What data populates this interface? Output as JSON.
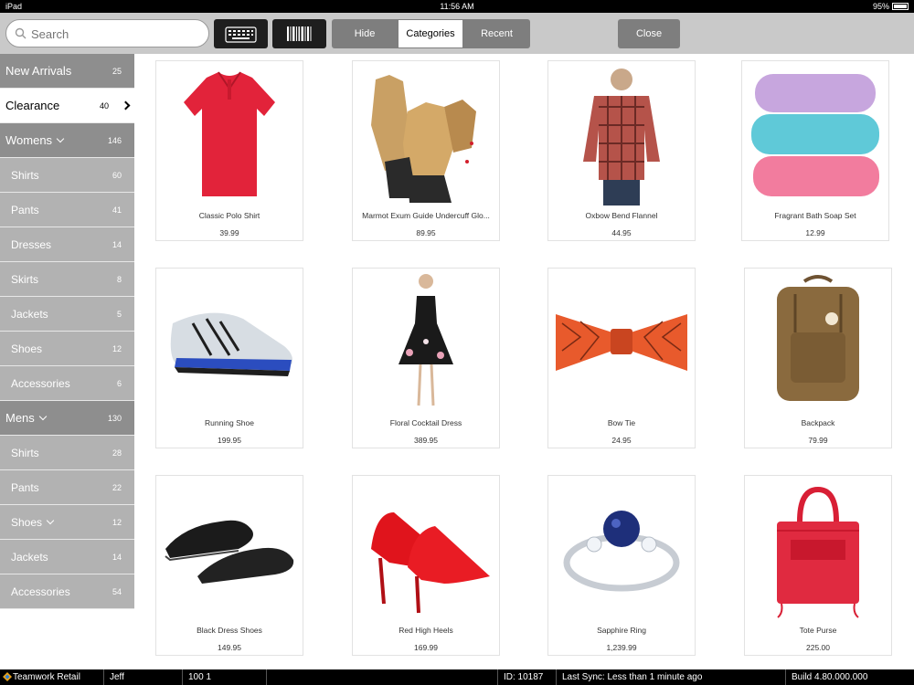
{
  "status_bar": {
    "device": "iPad",
    "time": "11:56 AM",
    "battery": "95%"
  },
  "toolbar": {
    "search_placeholder": "Search",
    "segments": [
      "Hide",
      "Categories",
      "Recent"
    ],
    "close_label": "Close"
  },
  "sidebar": {
    "items": [
      {
        "label": "New Arrivals",
        "count": "25"
      },
      {
        "label": "Clearance",
        "count": "40"
      },
      {
        "label": "Womens",
        "count": "146"
      },
      {
        "label": "Shirts",
        "count": "60"
      },
      {
        "label": "Pants",
        "count": "41"
      },
      {
        "label": "Dresses",
        "count": "14"
      },
      {
        "label": "Skirts",
        "count": "8"
      },
      {
        "label": "Jackets",
        "count": "5"
      },
      {
        "label": "Shoes",
        "count": "12"
      },
      {
        "label": "Accessories",
        "count": "6"
      },
      {
        "label": "Mens",
        "count": "130"
      },
      {
        "label": "Shirts",
        "count": "28"
      },
      {
        "label": "Pants",
        "count": "22"
      },
      {
        "label": "Shoes",
        "count": "12"
      },
      {
        "label": "Jackets",
        "count": "14"
      },
      {
        "label": "Accessories",
        "count": "54"
      }
    ]
  },
  "products": [
    {
      "name": "Classic Polo Shirt",
      "price": "39.99",
      "icon": "polo-shirt"
    },
    {
      "name": "Marmot Exum Guide Undercuff Glo...",
      "price": "89.95",
      "icon": "gloves"
    },
    {
      "name": "Oxbow Bend Flannel",
      "price": "44.95",
      "icon": "flannel-shirt"
    },
    {
      "name": "Fragrant Bath Soap Set",
      "price": "12.99",
      "icon": "soap-set"
    },
    {
      "name": "Running Shoe",
      "price": "199.95",
      "icon": "running-shoe"
    },
    {
      "name": "Floral Cocktail Dress",
      "price": "389.95",
      "icon": "dress"
    },
    {
      "name": "Bow Tie",
      "price": "24.95",
      "icon": "bow-tie"
    },
    {
      "name": "Backpack",
      "price": "79.99",
      "icon": "backpack"
    },
    {
      "name": "Black Dress Shoes",
      "price": "149.95",
      "icon": "dress-shoes"
    },
    {
      "name": "Red High Heels",
      "price": "169.99",
      "icon": "high-heels"
    },
    {
      "name": "Sapphire Ring",
      "price": "1,239.99",
      "icon": "ring"
    },
    {
      "name": "Tote Purse",
      "price": "225.00",
      "icon": "tote-purse"
    }
  ],
  "footer": {
    "app": "Teamwork Retail",
    "user": "Jeff",
    "location": "100 1",
    "id": "ID: 10187",
    "sync": "Last Sync: Less than 1 minute ago",
    "build": "Build 4.80.000.000"
  },
  "colors": {
    "toolbar_bg": "#c9c9c9",
    "category_bg": "#8e8e8e",
    "subcategory_bg": "#b2b2b2",
    "button_dark": "#1e1e1e",
    "button_gray": "#7e7e7e"
  }
}
